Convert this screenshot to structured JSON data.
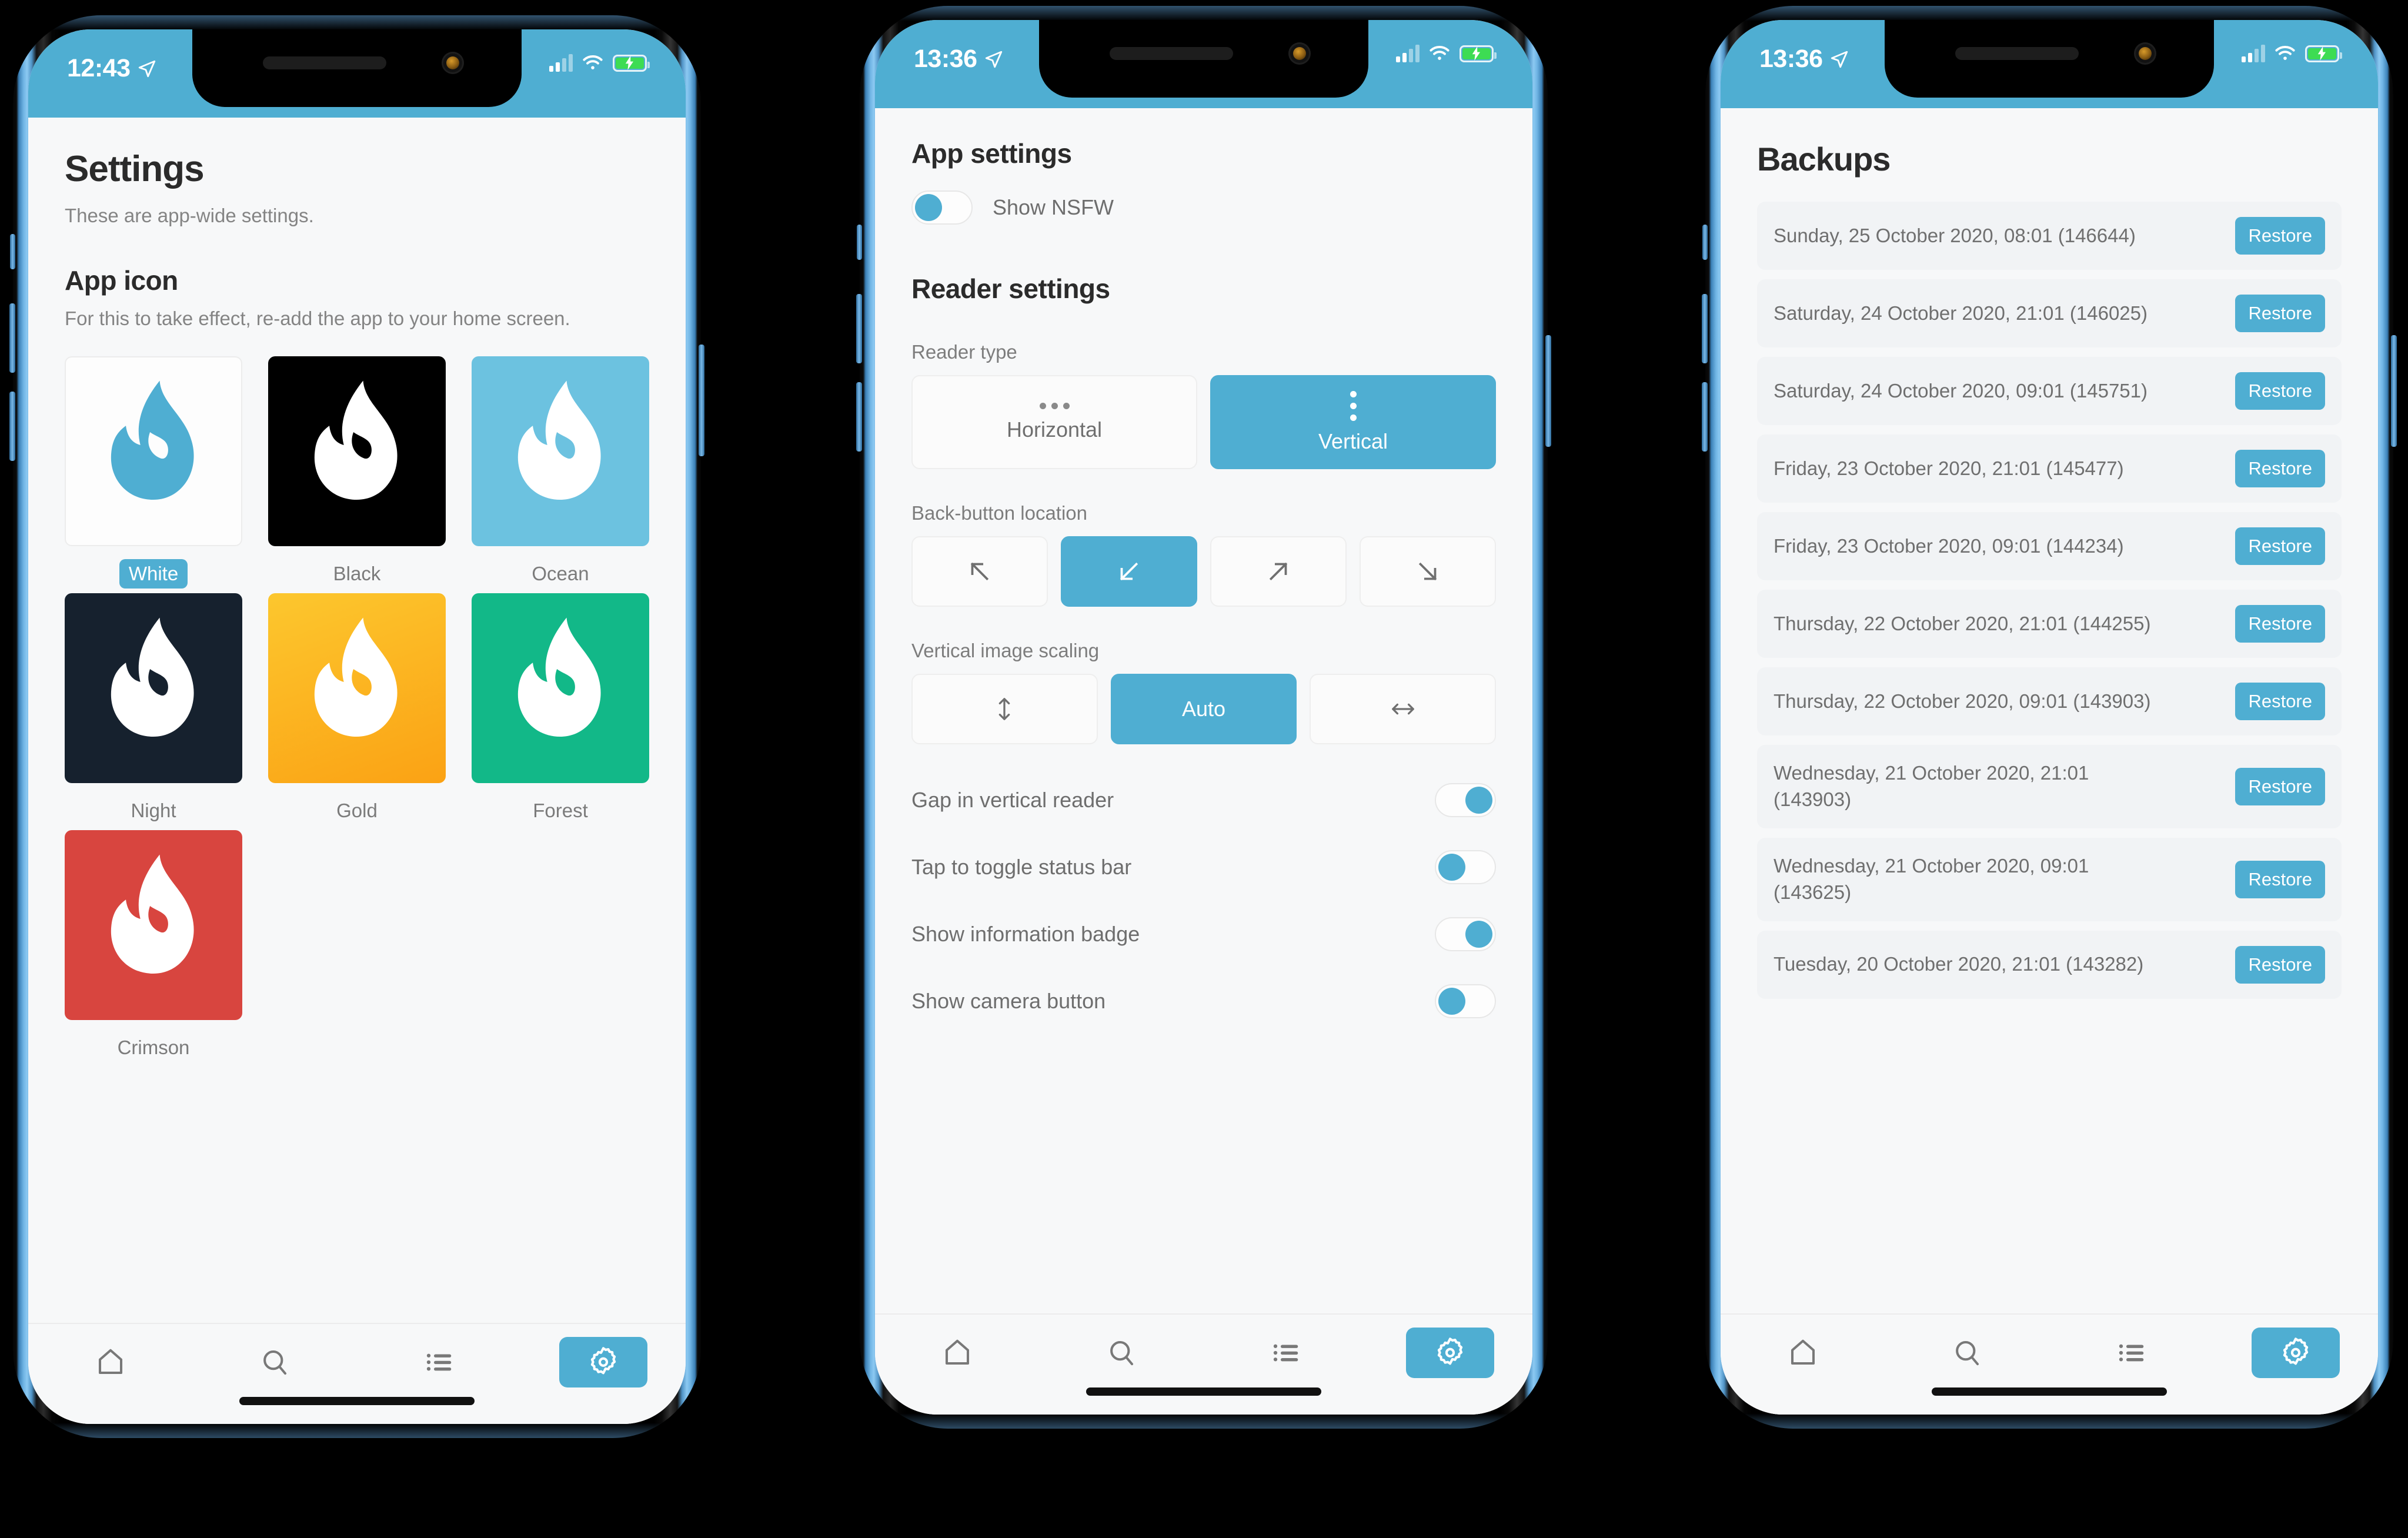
{
  "accent_color": "#4faed2",
  "phones": [
    {
      "status": {
        "time": "12:43",
        "battery_state": "charging"
      },
      "screen": {
        "title": "Settings",
        "subtitle": "These are app-wide settings.",
        "app_icon_section": {
          "heading": "App icon",
          "note": "For this to take effect, re-add the app to your home screen.",
          "selected": "White",
          "icons": [
            {
              "label": "White",
              "bg": "#fdfdfd",
              "flame": "#4faed2"
            },
            {
              "label": "Black",
              "bg": "#000000",
              "flame": "#ffffff"
            },
            {
              "label": "Ocean",
              "bg": "#6cc2e0",
              "flame": "#ffffff"
            },
            {
              "label": "Night",
              "bg": "#16212e",
              "flame": "#ffffff"
            },
            {
              "label": "Gold",
              "bg": "#fcbc2b",
              "flame": "#ffffff"
            },
            {
              "label": "Forest",
              "bg": "#12b888",
              "flame": "#ffffff"
            },
            {
              "label": "Crimson",
              "bg": "#d8453f",
              "flame": "#ffffff"
            }
          ]
        }
      }
    },
    {
      "status": {
        "time": "13:36",
        "battery_state": "charging"
      },
      "screen": {
        "app_settings_heading": "App settings",
        "nsfw_label": "Show NSFW",
        "nsfw_on": false,
        "reader_settings_heading": "Reader settings",
        "reader_type_label": "Reader type",
        "reader_types": [
          {
            "label": "Horizontal",
            "icon": "dots-horizontal-icon",
            "active": false
          },
          {
            "label": "Vertical",
            "icon": "dots-vertical-icon",
            "active": true
          }
        ],
        "back_button_label": "Back-button location",
        "back_button_options": [
          {
            "icon": "arrow-up-left-icon",
            "active": false
          },
          {
            "icon": "arrow-down-left-icon",
            "active": true
          },
          {
            "icon": "arrow-up-right-icon",
            "active": false
          },
          {
            "icon": "arrow-down-right-icon",
            "active": false
          }
        ],
        "scaling_label": "Vertical image scaling",
        "scaling_options": [
          {
            "label": "",
            "icon": "arrows-vertical-icon",
            "active": false
          },
          {
            "label": "Auto",
            "icon": "",
            "active": true
          },
          {
            "label": "",
            "icon": "arrows-horizontal-icon",
            "active": false
          }
        ],
        "toggles": [
          {
            "label": "Gap in vertical reader",
            "on": true
          },
          {
            "label": "Tap to toggle status bar",
            "on": false
          },
          {
            "label": "Show information badge",
            "on": true
          },
          {
            "label": "Show camera button",
            "on": false
          }
        ]
      }
    },
    {
      "status": {
        "time": "13:36",
        "battery_state": "charging"
      },
      "screen": {
        "title": "Backups",
        "restore_label": "Restore",
        "backups": [
          "Sunday, 25 October 2020, 08:01 (146644)",
          "Saturday, 24 October 2020, 21:01 (146025)",
          "Saturday, 24 October 2020, 09:01 (145751)",
          "Friday, 23 October 2020, 21:01 (145477)",
          "Friday, 23 October 2020, 09:01 (144234)",
          "Thursday, 22 October 2020, 21:01 (144255)",
          "Thursday, 22 October 2020, 09:01 (143903)",
          "Wednesday, 21 October 2020, 21:01 (143903)",
          "Wednesday, 21 October 2020, 09:01 (143625)",
          "Tuesday, 20 October 2020, 21:01 (143282)"
        ]
      }
    }
  ],
  "tabbar": {
    "items": [
      {
        "name": "home-icon",
        "active": false
      },
      {
        "name": "search-icon",
        "active": false
      },
      {
        "name": "list-icon",
        "active": false
      },
      {
        "name": "settings-gear-icon",
        "active": true
      }
    ]
  }
}
